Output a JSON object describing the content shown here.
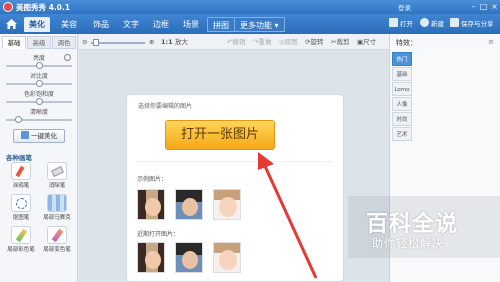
{
  "titlebar": {
    "title": "美图秀秀 4.0.1",
    "login": "登录",
    "controls": [
      "–",
      "□",
      "×"
    ]
  },
  "maintabs": [
    "美化",
    "美容",
    "饰品",
    "文字",
    "边框",
    "场景",
    "拼图",
    "更多功能 ▾"
  ],
  "home_icon": "home-icon",
  "right_tools": [
    {
      "label": "打开",
      "icon": "open-folder-icon"
    },
    {
      "label": "新建",
      "icon": "new-plus-icon"
    },
    {
      "label": "保存与分享",
      "icon": "save-icon"
    }
  ],
  "left": {
    "subtabs": [
      "基础",
      "高级",
      "调色"
    ],
    "sliders": [
      {
        "label": "亮度",
        "value": 0.5
      },
      {
        "label": "对比度",
        "value": 0.5
      },
      {
        "label": "色彩饱和度",
        "value": 0.5
      },
      {
        "label": "清晰度",
        "value": 0.18
      }
    ],
    "beautify_button": "一键美化",
    "section_title": "各种画笔",
    "tools": [
      "涂鸦笔",
      "消除笔",
      "抠图笔",
      "局部马赛克",
      "局部彩色笔",
      "局部变色笔"
    ]
  },
  "canvasbar": {
    "zoom_reset": "1:1",
    "enlarge": "放大",
    "undo": "撤销",
    "redo": "重做",
    "original": "原图",
    "rotate": "旋转",
    "crop": "裁剪",
    "size": "尺寸"
  },
  "card": {
    "choose_text": "选择你要编辑的图片",
    "open_button": "打开一张图片",
    "sample_label": "示例图片：",
    "recent_label": "近期打开图片："
  },
  "rightpanel": {
    "title": "特效：",
    "tabs": [
      "热门",
      "基础",
      "Lomo",
      "人像",
      "时尚",
      "艺术"
    ]
  },
  "watermark": {
    "title": "百科全说",
    "subtitle": "助你轻松解决"
  },
  "colors": {
    "titlebar": "#2f74c3",
    "accent_orange": "#f4a816",
    "tab_active": "#4d93da",
    "arrow": "#e53935"
  }
}
